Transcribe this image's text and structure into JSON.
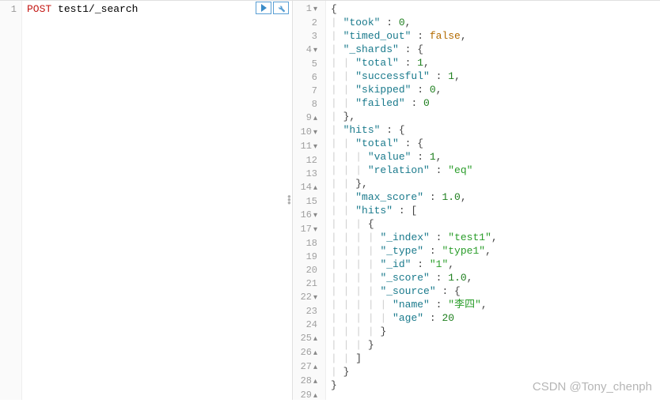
{
  "left": {
    "lineNumber": "1",
    "method": "POST",
    "path": "test1/_search"
  },
  "right": {
    "lines": [
      {
        "n": "1",
        "f": "▾",
        "indent": 0,
        "t": [
          {
            "c": "punct",
            "v": "{"
          }
        ]
      },
      {
        "n": "2",
        "indent": 1,
        "t": [
          {
            "c": "key",
            "v": "\"took\""
          },
          {
            "c": "punct",
            "v": " : "
          },
          {
            "c": "num",
            "v": "0"
          },
          {
            "c": "punct",
            "v": ","
          }
        ]
      },
      {
        "n": "3",
        "indent": 1,
        "t": [
          {
            "c": "key",
            "v": "\"timed_out\""
          },
          {
            "c": "punct",
            "v": " : "
          },
          {
            "c": "bool",
            "v": "false"
          },
          {
            "c": "punct",
            "v": ","
          }
        ]
      },
      {
        "n": "4",
        "f": "▾",
        "indent": 1,
        "t": [
          {
            "c": "key",
            "v": "\"_shards\""
          },
          {
            "c": "punct",
            "v": " : {"
          }
        ]
      },
      {
        "n": "5",
        "indent": 2,
        "t": [
          {
            "c": "key",
            "v": "\"total\""
          },
          {
            "c": "punct",
            "v": " : "
          },
          {
            "c": "num",
            "v": "1"
          },
          {
            "c": "punct",
            "v": ","
          }
        ]
      },
      {
        "n": "6",
        "indent": 2,
        "t": [
          {
            "c": "key",
            "v": "\"successful\""
          },
          {
            "c": "punct",
            "v": " : "
          },
          {
            "c": "num",
            "v": "1"
          },
          {
            "c": "punct",
            "v": ","
          }
        ]
      },
      {
        "n": "7",
        "indent": 2,
        "t": [
          {
            "c": "key",
            "v": "\"skipped\""
          },
          {
            "c": "punct",
            "v": " : "
          },
          {
            "c": "num",
            "v": "0"
          },
          {
            "c": "punct",
            "v": ","
          }
        ]
      },
      {
        "n": "8",
        "indent": 2,
        "t": [
          {
            "c": "key",
            "v": "\"failed\""
          },
          {
            "c": "punct",
            "v": " : "
          },
          {
            "c": "num",
            "v": "0"
          }
        ]
      },
      {
        "n": "9",
        "f": "▴",
        "indent": 1,
        "t": [
          {
            "c": "punct",
            "v": "},"
          }
        ]
      },
      {
        "n": "10",
        "f": "▾",
        "indent": 1,
        "t": [
          {
            "c": "key",
            "v": "\"hits\""
          },
          {
            "c": "punct",
            "v": " : {"
          }
        ]
      },
      {
        "n": "11",
        "f": "▾",
        "indent": 2,
        "t": [
          {
            "c": "key",
            "v": "\"total\""
          },
          {
            "c": "punct",
            "v": " : {"
          }
        ]
      },
      {
        "n": "12",
        "indent": 3,
        "t": [
          {
            "c": "key",
            "v": "\"value\""
          },
          {
            "c": "punct",
            "v": " : "
          },
          {
            "c": "num",
            "v": "1"
          },
          {
            "c": "punct",
            "v": ","
          }
        ]
      },
      {
        "n": "13",
        "indent": 3,
        "t": [
          {
            "c": "key",
            "v": "\"relation\""
          },
          {
            "c": "punct",
            "v": " : "
          },
          {
            "c": "hlstr",
            "v": "\"eq\""
          }
        ]
      },
      {
        "n": "14",
        "f": "▴",
        "indent": 2,
        "t": [
          {
            "c": "punct",
            "v": "},"
          }
        ]
      },
      {
        "n": "15",
        "indent": 2,
        "t": [
          {
            "c": "key",
            "v": "\"max_score\""
          },
          {
            "c": "punct",
            "v": " : "
          },
          {
            "c": "num",
            "v": "1.0"
          },
          {
            "c": "punct",
            "v": ","
          }
        ]
      },
      {
        "n": "16",
        "f": "▾",
        "indent": 2,
        "t": [
          {
            "c": "key",
            "v": "\"hits\""
          },
          {
            "c": "punct",
            "v": " : ["
          }
        ]
      },
      {
        "n": "17",
        "f": "▾",
        "indent": 3,
        "t": [
          {
            "c": "punct",
            "v": "{"
          }
        ]
      },
      {
        "n": "18",
        "indent": 4,
        "t": [
          {
            "c": "key",
            "v": "\"_index\""
          },
          {
            "c": "punct",
            "v": " : "
          },
          {
            "c": "hlstr",
            "v": "\"test1\""
          },
          {
            "c": "punct",
            "v": ","
          }
        ]
      },
      {
        "n": "19",
        "indent": 4,
        "t": [
          {
            "c": "key",
            "v": "\"_type\""
          },
          {
            "c": "punct",
            "v": " : "
          },
          {
            "c": "hlstr",
            "v": "\"type1\""
          },
          {
            "c": "punct",
            "v": ","
          }
        ]
      },
      {
        "n": "20",
        "indent": 4,
        "t": [
          {
            "c": "key",
            "v": "\"_id\""
          },
          {
            "c": "punct",
            "v": " : "
          },
          {
            "c": "hlstr",
            "v": "\"1\""
          },
          {
            "c": "punct",
            "v": ","
          }
        ]
      },
      {
        "n": "21",
        "indent": 4,
        "t": [
          {
            "c": "key",
            "v": "\"_score\""
          },
          {
            "c": "punct",
            "v": " : "
          },
          {
            "c": "num",
            "v": "1.0"
          },
          {
            "c": "punct",
            "v": ","
          }
        ]
      },
      {
        "n": "22",
        "f": "▾",
        "indent": 4,
        "t": [
          {
            "c": "key",
            "v": "\"_source\""
          },
          {
            "c": "punct",
            "v": " : {"
          }
        ]
      },
      {
        "n": "23",
        "indent": 5,
        "t": [
          {
            "c": "key",
            "v": "\"name\""
          },
          {
            "c": "punct",
            "v": " : "
          },
          {
            "c": "hlstr",
            "v": "\"李四\""
          },
          {
            "c": "punct",
            "v": ","
          }
        ]
      },
      {
        "n": "24",
        "indent": 5,
        "t": [
          {
            "c": "key",
            "v": "\"age\""
          },
          {
            "c": "punct",
            "v": " : "
          },
          {
            "c": "num",
            "v": "20"
          }
        ]
      },
      {
        "n": "25",
        "f": "▴",
        "indent": 4,
        "t": [
          {
            "c": "punct",
            "v": "}"
          }
        ]
      },
      {
        "n": "26",
        "f": "▴",
        "indent": 3,
        "t": [
          {
            "c": "punct",
            "v": "}"
          }
        ]
      },
      {
        "n": "27",
        "f": "▴",
        "indent": 2,
        "t": [
          {
            "c": "punct",
            "v": "]"
          }
        ]
      },
      {
        "n": "28",
        "f": "▴",
        "indent": 1,
        "t": [
          {
            "c": "punct",
            "v": "}"
          }
        ]
      },
      {
        "n": "29",
        "f": "▴",
        "indent": 0,
        "t": [
          {
            "c": "punct",
            "v": "}"
          }
        ]
      }
    ]
  },
  "watermark": "CSDN @Tony_chenph"
}
